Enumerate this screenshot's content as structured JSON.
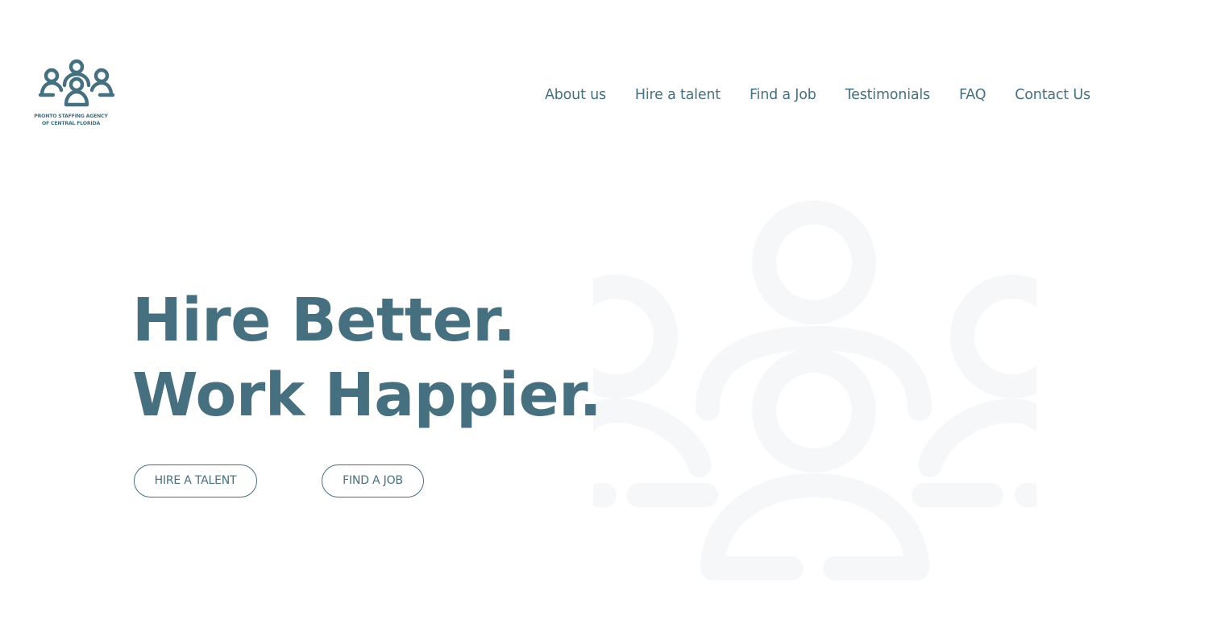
{
  "logo": {
    "icon": "people-group-icon",
    "caption_line1": "PRONTO STAFFING AGENCY",
    "caption_line2": "OF CENTRAL FLORIDA"
  },
  "nav": {
    "items": [
      {
        "label": "About us"
      },
      {
        "label": "Hire a talent"
      },
      {
        "label": "Find a Job"
      },
      {
        "label": "Testimonials"
      },
      {
        "label": "FAQ"
      },
      {
        "label": "Contact Us"
      }
    ]
  },
  "hero": {
    "headline_line1": "Hire Better.",
    "headline_line2": "Work Happier.",
    "cta_hire_label": "HIRE A TALENT",
    "cta_find_label": "FIND A JOB",
    "background_icon": "people-group-icon"
  },
  "colors": {
    "brand": "#46707f",
    "background_art": "#f6f7f9",
    "page_background": "#ffffff"
  }
}
